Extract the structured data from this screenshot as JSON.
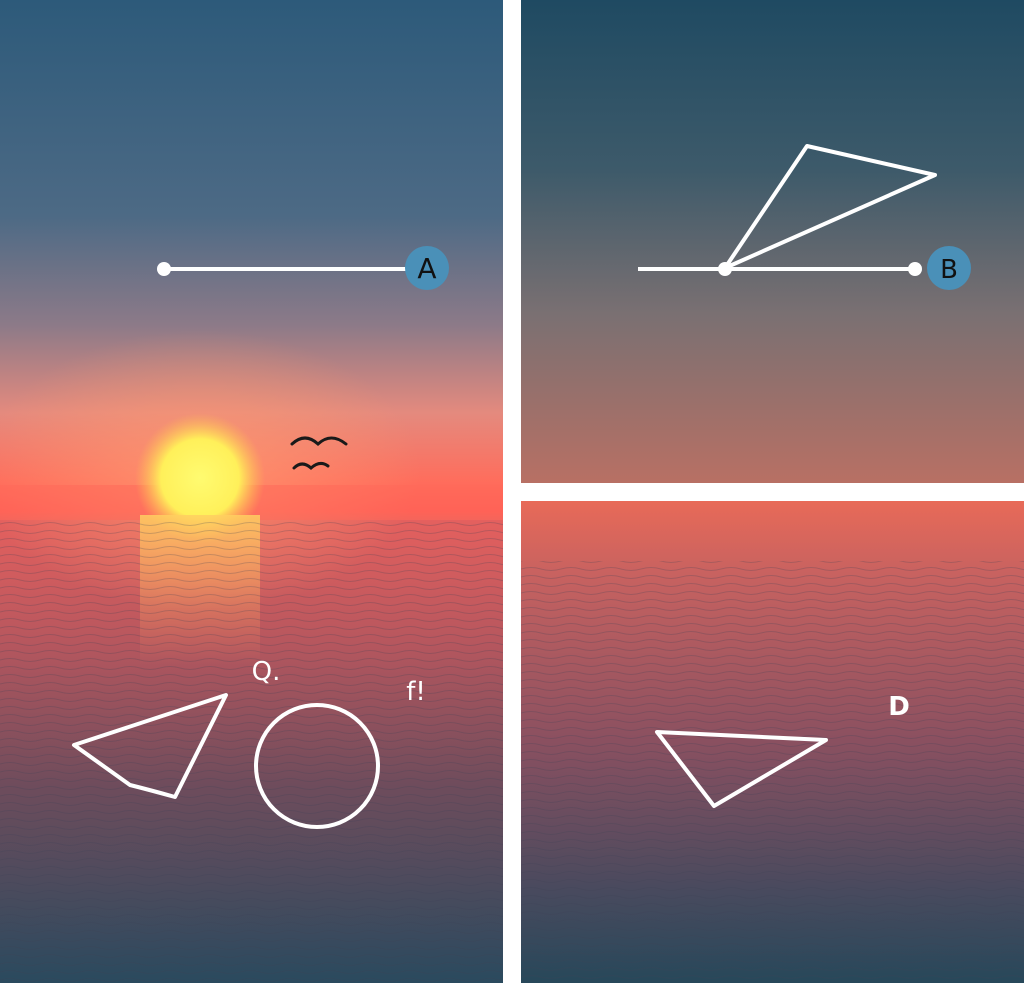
{
  "panels": {
    "left": {
      "marker_label": "A",
      "glyph_1": "Q.",
      "glyph_2": "f!"
    },
    "top_right": {
      "marker_label": "B"
    },
    "bottom_right": {
      "letter_label": "D"
    }
  },
  "colors": {
    "marker_fill": "#4a90b8",
    "outline": "#ffffff",
    "sun": "#fff15a",
    "sky_top": "#2f5b7a",
    "horizon": "#ff6a5a",
    "sea_dark": "#27485a"
  },
  "icons": [
    "birds-icon",
    "point-dot-icon"
  ]
}
